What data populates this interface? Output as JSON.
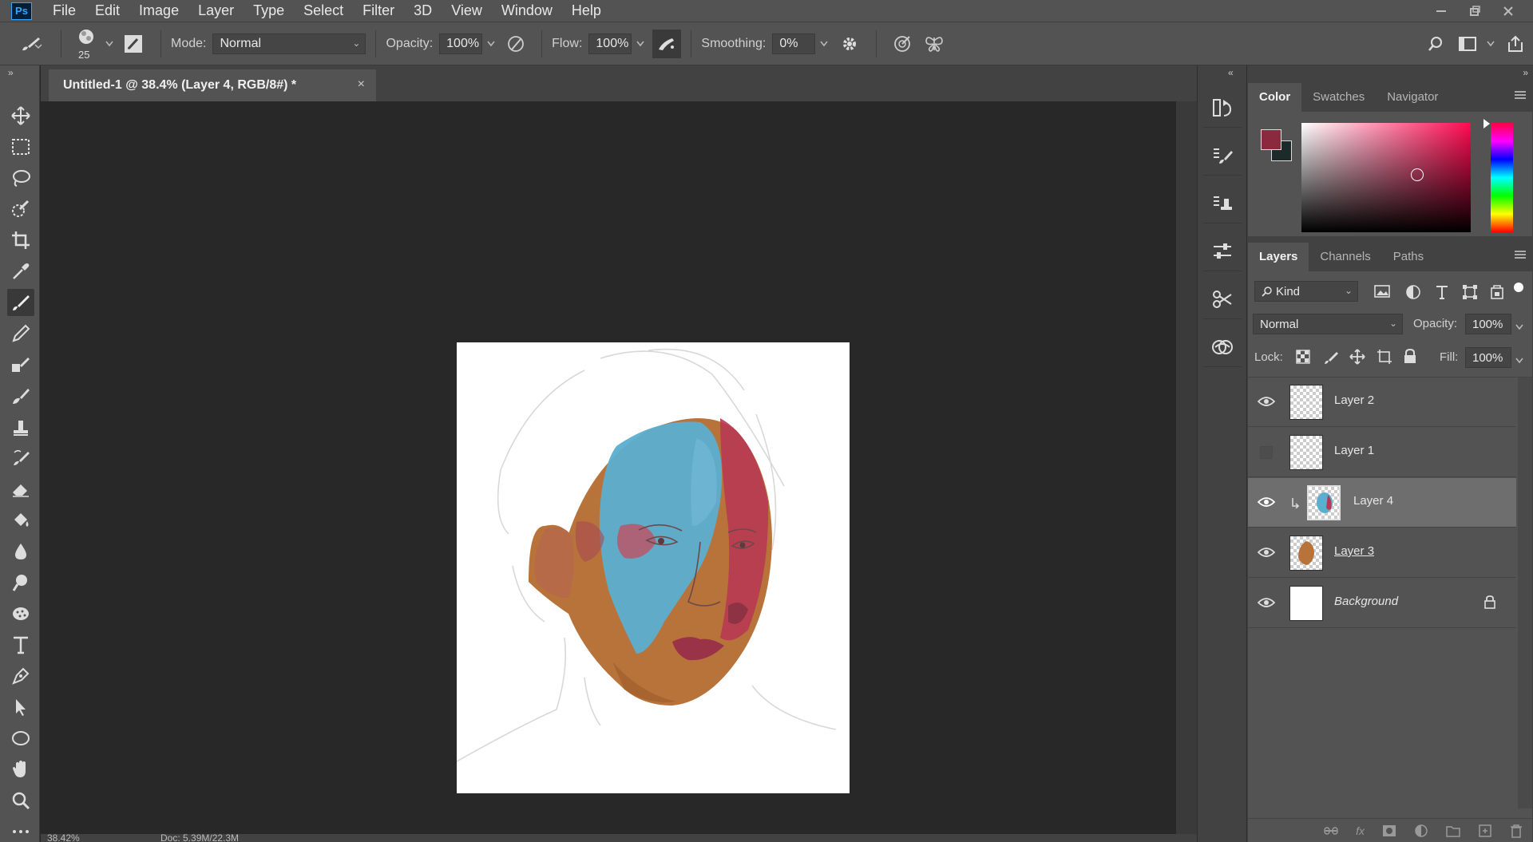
{
  "app": {
    "logo": "Ps"
  },
  "menu": [
    "File",
    "Edit",
    "Image",
    "Layer",
    "Type",
    "Select",
    "Filter",
    "3D",
    "View",
    "Window",
    "Help"
  ],
  "options": {
    "brush_size": "25",
    "mode_label": "Mode:",
    "mode_value": "Normal",
    "opacity_label": "Opacity:",
    "opacity_value": "100%",
    "flow_label": "Flow:",
    "flow_value": "100%",
    "smoothing_label": "Smoothing:",
    "smoothing_value": "0%"
  },
  "document": {
    "tab_title": "Untitled-1 @ 38.4% (Layer 4, RGB/8#) *",
    "close": "×",
    "status_zoom": "38.42%",
    "status_doc": "Doc: 5.39M/22.3M"
  },
  "color_panel": {
    "tabs": [
      "Color",
      "Swatches",
      "Navigator"
    ],
    "foreground": "#8b2a3e",
    "background": "#1d2a2a",
    "hue": "#ff0a50"
  },
  "layers_panel": {
    "tabs": [
      "Layers",
      "Channels",
      "Paths"
    ],
    "filter_kind": "Kind",
    "blend_mode": "Normal",
    "opacity_label": "Opacity:",
    "opacity_value": "100%",
    "lock_label": "Lock:",
    "fill_label": "Fill:",
    "fill_value": "100%",
    "layers": [
      {
        "name": "Layer 2",
        "visible": true
      },
      {
        "name": "Layer 1",
        "visible": false
      },
      {
        "name": "Layer 4",
        "visible": true,
        "selected": true,
        "clipped": true
      },
      {
        "name": "Layer 3",
        "visible": true
      },
      {
        "name": "Background",
        "visible": true,
        "locked": true
      }
    ]
  }
}
